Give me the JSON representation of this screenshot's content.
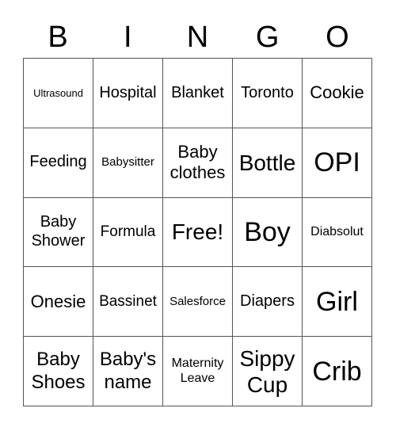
{
  "header": {
    "letters": [
      "B",
      "I",
      "N",
      "G",
      "O"
    ]
  },
  "board": {
    "rows": [
      [
        "Ultrasound",
        "Hospital",
        "Blanket",
        "Toronto",
        "Cookie"
      ],
      [
        "Feeding",
        "Babysitter",
        "Baby clothes",
        "Bottle",
        "OPI"
      ],
      [
        "Baby Shower",
        "Formula",
        "Free!",
        "Boy",
        "Diabsolut"
      ],
      [
        "Onesie",
        "Bassinet",
        "Salesforce",
        "Diapers",
        "Girl"
      ],
      [
        "Baby Shoes",
        "Baby's name",
        "Maternity Leave",
        "Sippy Cup",
        "Crib"
      ]
    ]
  }
}
